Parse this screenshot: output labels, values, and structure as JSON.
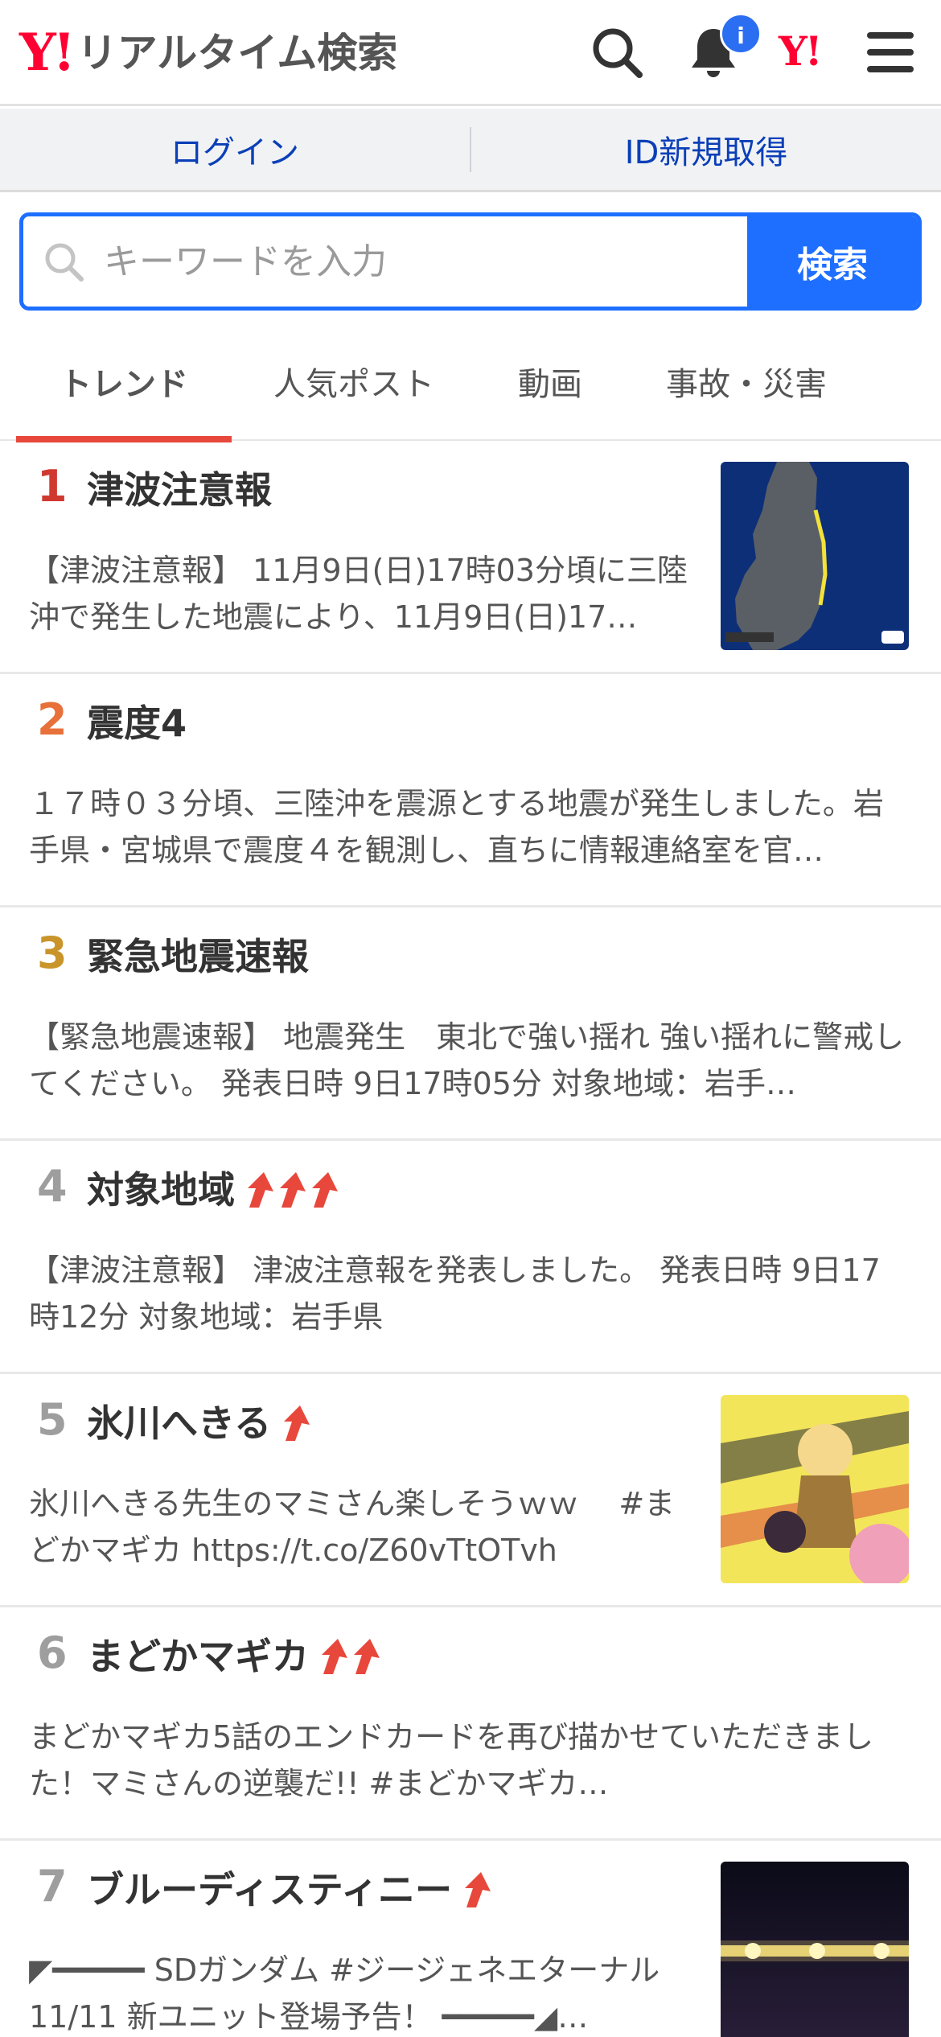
{
  "header": {
    "logo_mark": "Y!",
    "logo_text": "リアルタイム検索",
    "notification_badge": "i",
    "yj_mark": "Y!"
  },
  "account": {
    "login": "ログイン",
    "register": "ID新規取得"
  },
  "search": {
    "placeholder": "キーワードを入力",
    "button": "検索"
  },
  "tabs": [
    {
      "label": "トレンド",
      "active": true
    },
    {
      "label": "人気ポスト",
      "active": false
    },
    {
      "label": "動画",
      "active": false
    },
    {
      "label": "事故・災害",
      "active": false
    }
  ],
  "colors": {
    "brand_red": "#ff0033",
    "accent_blue": "#1e6fff",
    "rank1": "#d0392f",
    "rank2": "#e8703a",
    "rank3": "#c9952b",
    "rank_other": "#9e9e9e",
    "arrow": "#e8473b"
  },
  "trends": [
    {
      "rank": "1",
      "title": "津波注意報",
      "arrows": 0,
      "has_thumb": true,
      "thumb": "tsunami-map-thumbnail",
      "desc": "【津波注意報】 11月9日(日)17時03分頃に三陸沖で発生した地震により、11月9日(日)17…"
    },
    {
      "rank": "2",
      "title": "震度4",
      "arrows": 0,
      "has_thumb": false,
      "desc": "１７時０３分頃、三陸沖を震源とする地震が発生しました。岩手県・宮城県で震度４を観測し、直ちに情報連絡室を官…"
    },
    {
      "rank": "3",
      "title": "緊急地震速報",
      "arrows": 0,
      "has_thumb": false,
      "desc": "【緊急地震速報】 地震発生　東北で強い揺れ 強い揺れに警戒してください。 発表日時 9日17時05分 対象地域：岩手…"
    },
    {
      "rank": "4",
      "title": "対象地域",
      "arrows": 3,
      "has_thumb": false,
      "desc": "【津波注意報】 津波注意報を発表しました。 発表日時 9日17時12分 対象地域：岩手県"
    },
    {
      "rank": "5",
      "title": "氷川へきる",
      "arrows": 1,
      "has_thumb": true,
      "thumb": "anime-illustration-thumbnail",
      "desc": "氷川へきる先生のマミさん楽しそうｗｗ　 #まどかマギカ https://t.co/Z60vTtOTvh"
    },
    {
      "rank": "6",
      "title": "まどかマギカ",
      "arrows": 2,
      "has_thumb": false,
      "desc": "まどかマギカ5話のエンドカードを再び描かせていただきました！マミさんの逆襲だ!! #まどかマギカ…"
    },
    {
      "rank": "7",
      "title": "ブルーディスティニー",
      "arrows": 1,
      "has_thumb": true,
      "thumb": "light-streak-thumbnail",
      "desc": "◤━━━━━ SDガンダム #ジージェネエターナル 11/11 新ユニット登場予告！ ━━━━━◢…"
    }
  ]
}
